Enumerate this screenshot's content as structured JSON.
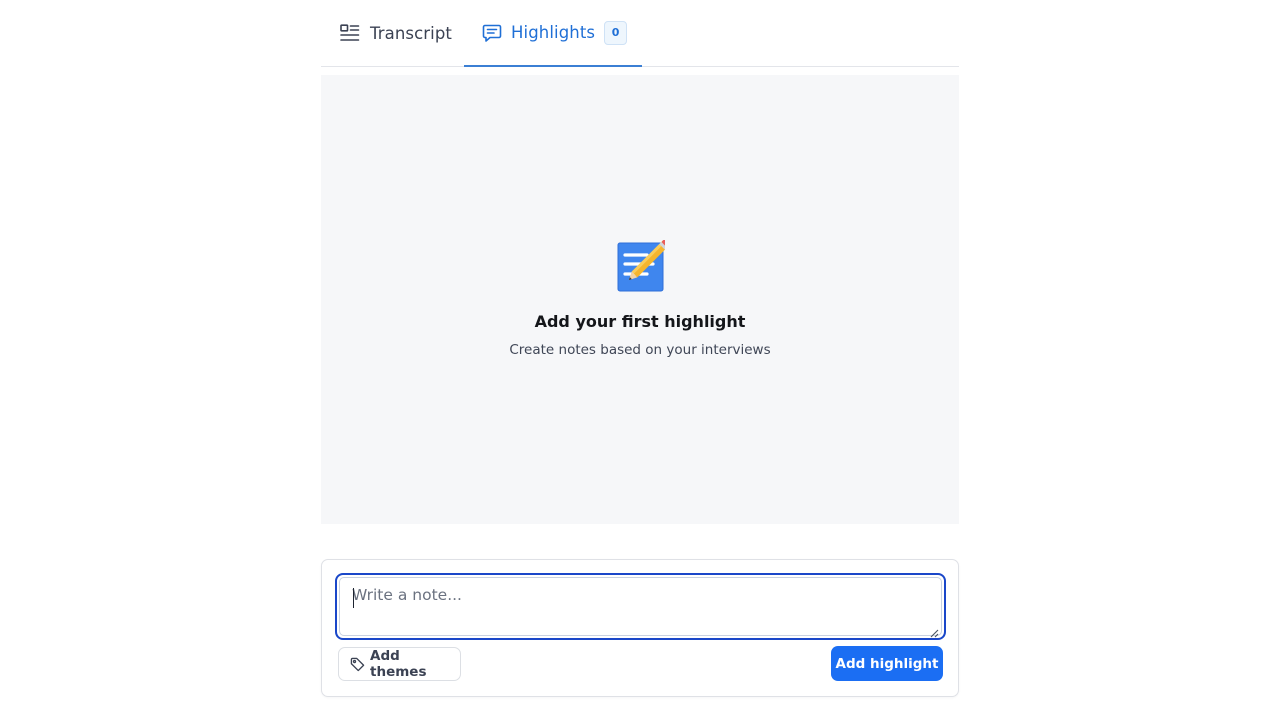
{
  "tabs": [
    {
      "label": "Transcript",
      "icon": "transcript-icon",
      "active": false
    },
    {
      "label": "Highlights",
      "icon": "highlights-icon",
      "active": true,
      "count": "0"
    }
  ],
  "empty_state": {
    "icon": "notepad-pencil-icon",
    "title": "Add your first highlight",
    "subtitle": "Create notes based on your interviews"
  },
  "composer": {
    "note_placeholder": "Write a note...",
    "note_value": "",
    "themes_button": {
      "label": "Add themes",
      "icon": "tag-icon"
    },
    "add_button": {
      "label": "Add highlight"
    }
  },
  "colors": {
    "accent": "#1b6ef3",
    "active_tab": "#1f6fd6",
    "focus_ring": "#1a47c9",
    "panel_bg": "#f6f7f9"
  }
}
